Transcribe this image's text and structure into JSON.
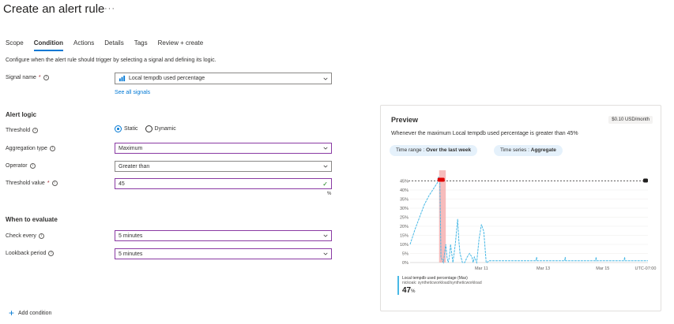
{
  "page": {
    "title": "Create an alert rule",
    "more": "···"
  },
  "tabs": [
    {
      "label": "Scope"
    },
    {
      "label": "Condition",
      "active": true
    },
    {
      "label": "Actions"
    },
    {
      "label": "Details"
    },
    {
      "label": "Tags"
    },
    {
      "label": "Review + create"
    }
  ],
  "condition": {
    "description": "Configure when the alert rule should trigger by selecting a signal and defining its logic.",
    "signal_label": "Signal name",
    "signal_value": "Local tempdb used percentage",
    "see_all": "See all signals",
    "alert_logic_title": "Alert logic",
    "threshold_label": "Threshold",
    "threshold_options": [
      "Static",
      "Dynamic"
    ],
    "threshold_selected": "Static",
    "aggregation_label": "Aggregation type",
    "aggregation_value": "Maximum",
    "operator_label": "Operator",
    "operator_value": "Greater than",
    "threshold_value_label": "Threshold value",
    "threshold_value": "45",
    "threshold_unit": "%",
    "evaluate_title": "When to evaluate",
    "check_every_label": "Check every",
    "check_every_value": "5 minutes",
    "lookback_label": "Lookback period",
    "lookback_value": "5 minutes",
    "add_condition": "Add condition"
  },
  "preview": {
    "title": "Preview",
    "price": "$0.10 USD/month",
    "description": "Whenever the maximum Local tempdb used percentage is greater than 45%",
    "time_range_label": "Time range : ",
    "time_range_value": "Over the last week",
    "time_series_label": "Time series : ",
    "time_series_value": "Aggregate",
    "legend_metric": "Local tempdb used percentage (Max)",
    "legend_resource": "nickoak: syntheticworkload/syntheticworkload",
    "legend_value": "47",
    "legend_unit": "%"
  },
  "colors": {
    "accent": "#0078d4",
    "series": "#49b9e6",
    "threshold_line": "#323130",
    "alert_region": "#f4a5a5",
    "alert_marker": "#e00000",
    "field_focus": "#8a3aa3"
  },
  "chart_data": {
    "type": "line",
    "y_ticks": [
      "45%",
      "40%",
      "35%",
      "30%",
      "25%",
      "20%",
      "15%",
      "10%",
      "5%",
      "0%"
    ],
    "x_ticks": [
      "Mar 11",
      "Mar 13",
      "Mar 15",
      "UTC-07:00"
    ],
    "ylim": [
      0,
      47
    ],
    "xlim": [
      0,
      100
    ],
    "threshold": 45,
    "series": [
      {
        "x": [
          0,
          2,
          4,
          6,
          8,
          10,
          11.5,
          12,
          12.5,
          13,
          14,
          15,
          15.5,
          16,
          16.5,
          17,
          17.5,
          18,
          19,
          20,
          20.5,
          21,
          22,
          23,
          24,
          25,
          26,
          26.5,
          27,
          28,
          29,
          30,
          31,
          32,
          32.5,
          33,
          35,
          40,
          45,
          50,
          53,
          53.2,
          53.4,
          55,
          60,
          65,
          65.2,
          65.4,
          70,
          78,
          78.2,
          78.4,
          85,
          90,
          90.2,
          90.4,
          95,
          100
        ],
        "y": [
          10,
          18,
          25,
          32,
          37,
          41,
          44,
          47,
          46,
          3,
          0,
          10,
          3,
          0,
          3,
          10,
          5,
          0,
          10,
          24,
          12,
          5,
          0,
          0,
          3,
          5,
          3,
          0,
          3,
          0,
          13,
          21,
          17,
          0,
          0,
          1,
          1,
          1,
          1,
          1,
          1,
          3,
          1,
          1,
          1,
          1,
          3,
          1,
          1,
          1,
          3,
          1,
          1,
          1,
          3,
          1,
          1,
          1
        ]
      }
    ],
    "alert_window_x": [
      12.2,
      15
    ],
    "grid": true
  }
}
